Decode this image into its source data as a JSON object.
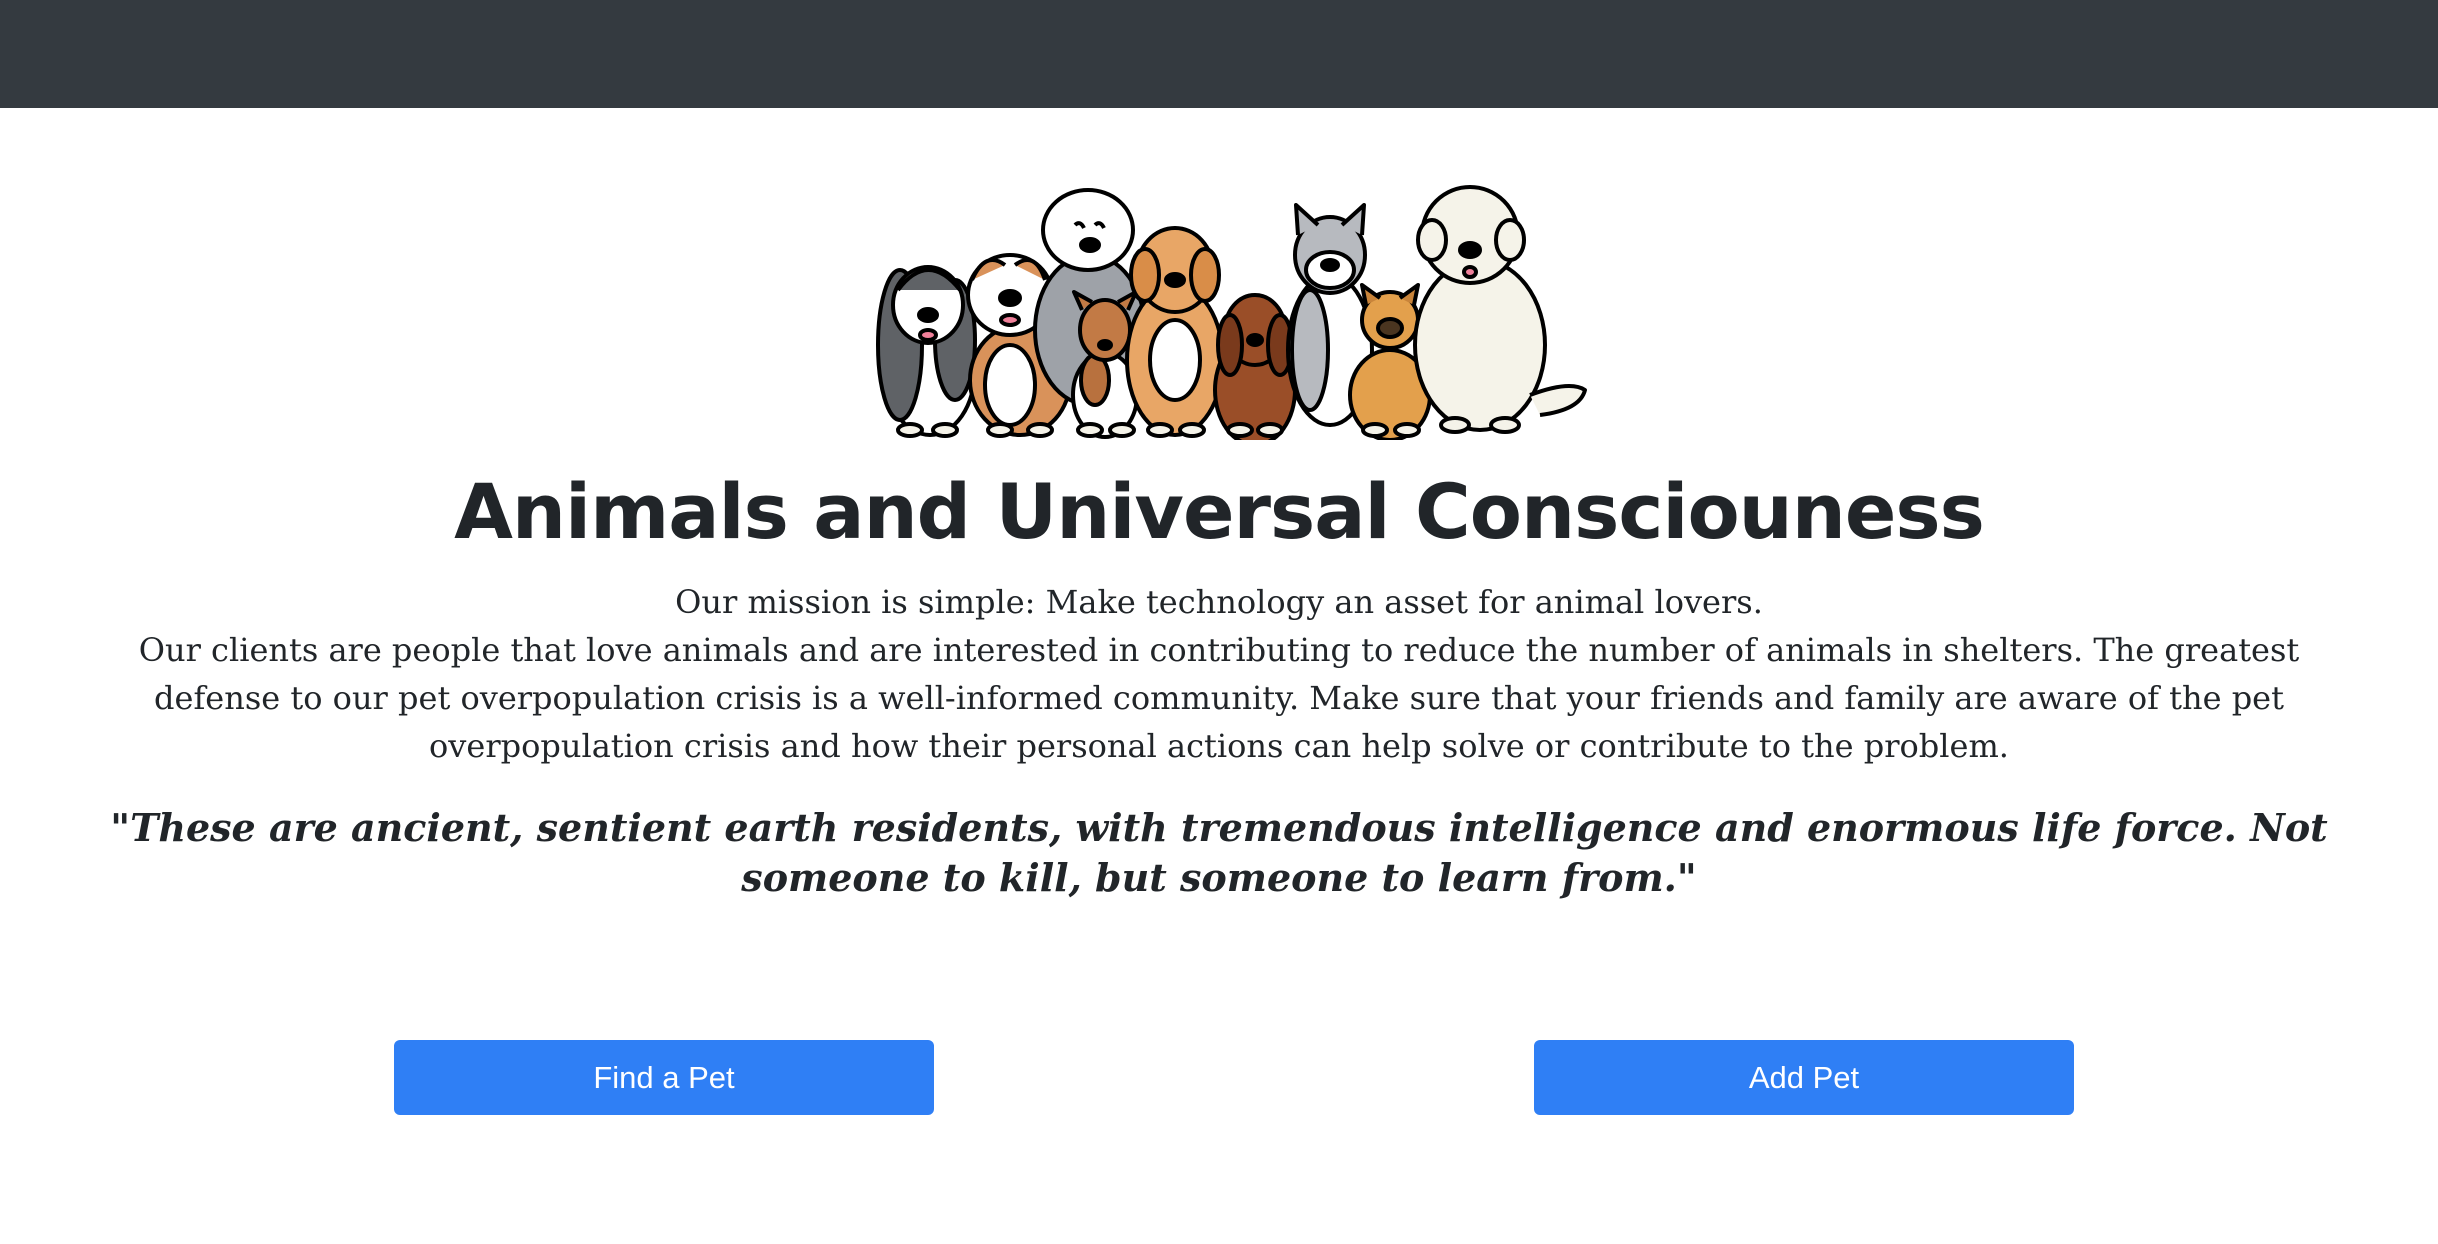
{
  "header": {
    "bar_color": "#343a40"
  },
  "hero": {
    "image_icon": "group-of-dogs-illustration"
  },
  "main": {
    "title": "Animals and Universal Consciouness",
    "mission_line1": "Our mission is simple: Make technology an asset for animal lovers.",
    "mission_line2": "Our clients are people that love animals and are interested in contributing to reduce the number of animals in shelters. The greatest defense to our pet overpopulation crisis is a well-informed community. Make sure that your friends and family are aware of the pet overpopulation crisis and how their personal actions can help solve or contribute to the problem.",
    "quote": "\"These are ancient, sentient earth residents, with tremendous intelligence and enormous life force. Not someone to kill, but someone to learn from.\""
  },
  "actions": {
    "find_label": "Find a Pet",
    "add_label": "Add Pet",
    "button_color": "#2f7ff5"
  }
}
